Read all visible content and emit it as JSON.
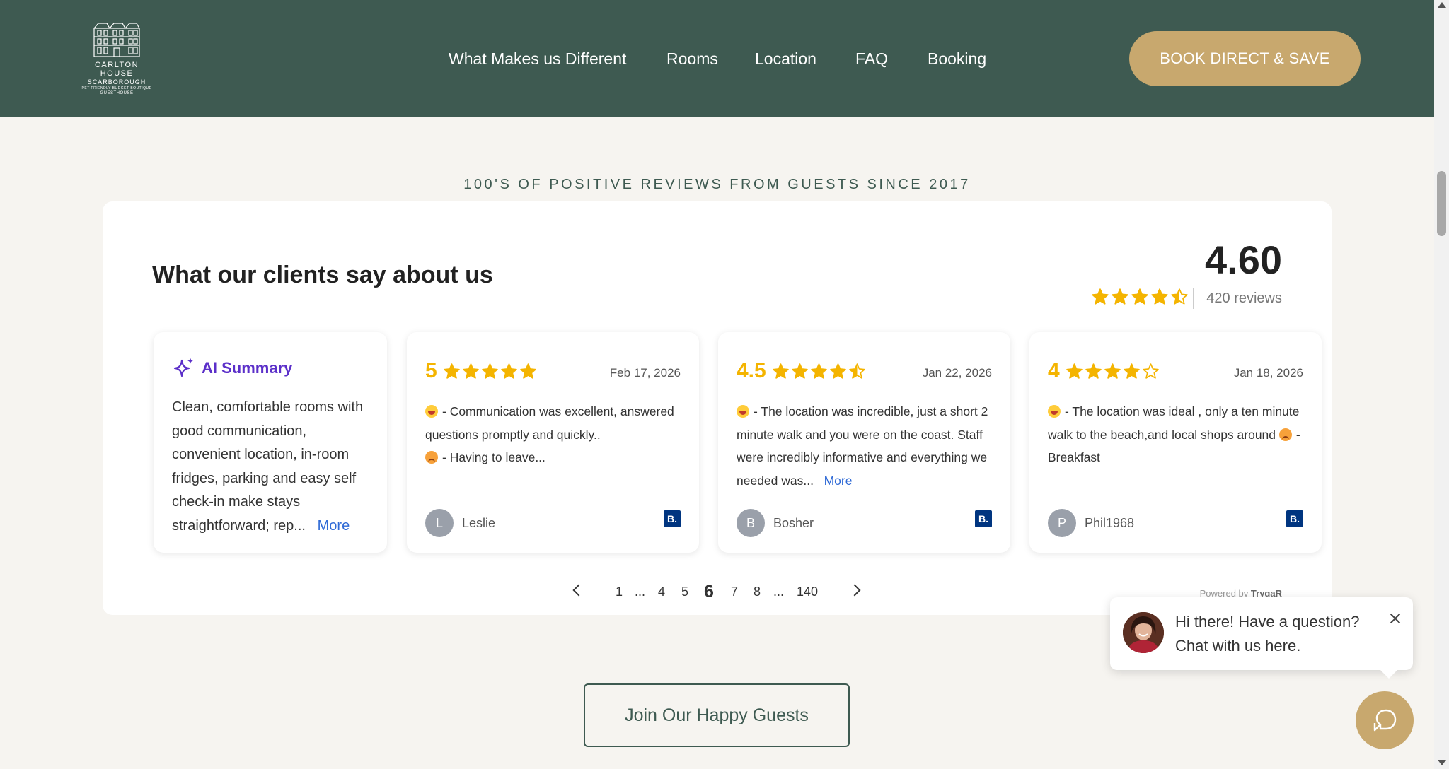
{
  "header": {
    "logo": {
      "line1": "CARLTON HOUSE",
      "line2": "SCARBOROUGH",
      "line3": "PET FRIENDLY BUDGET BOUTIQUE",
      "line4": "GUESTHOUSE"
    },
    "nav": [
      "What Makes us Different",
      "Rooms",
      "Location",
      "FAQ",
      "Booking"
    ],
    "cta": "BOOK DIRECT & SAVE"
  },
  "section_heading": "100'S OF POSITIVE REVIEWS FROM GUESTS SINCE 2017",
  "widget": {
    "title": "What our clients say about us",
    "score": "4.60",
    "reviews_count": "420 reviews",
    "overall_rating": 4.6,
    "ai_summary": {
      "title": "AI Summary",
      "text": "Clean, comfortable rooms with good communication, convenient location, in-room fridges, parking and easy self check-in make stays straightforward; rep...",
      "more": "More"
    },
    "reviews": [
      {
        "score": "5",
        "rating": 5,
        "date": "Feb 17, 2026",
        "positive": "- Communication was excellent, answered questions promptly and quickly..",
        "negative": "- Having to leave...",
        "more": "",
        "initial": "L",
        "name": "Leslie",
        "source": "B."
      },
      {
        "score": "4.5",
        "rating": 4.5,
        "date": "Jan 22, 2026",
        "positive": "- The location was incredible, just a short 2 minute walk and you were on the coast. Staff were incredibly informative and everything we needed was...",
        "negative": "",
        "more": "More",
        "initial": "B",
        "name": "Bosher",
        "source": "B."
      },
      {
        "score": "4",
        "rating": 4,
        "date": "Jan 18, 2026",
        "positive": "- The location was ideal , only a ten minute walk to the beach,and local shops around",
        "negative": "- Breakfast",
        "more": "",
        "initial": "P",
        "name": "Phil1968",
        "source": "B."
      }
    ],
    "pagination": {
      "pages": [
        "1",
        "...",
        "4",
        "5",
        "6",
        "7",
        "8",
        "...",
        "140"
      ],
      "current": "6"
    },
    "powered_by": "Powered by",
    "powered_brand": "TrygaR"
  },
  "join_button": "Join Our Happy Guests",
  "chat": {
    "message": "Hi there! Have a question? Chat with us here."
  },
  "colors": {
    "header_bg": "#3e5a51",
    "accent_gold": "#c8a86e",
    "star": "#f4b400",
    "ai_purple": "#5b2fc9",
    "link_blue": "#2f6ad6",
    "booking_blue": "#003580"
  }
}
